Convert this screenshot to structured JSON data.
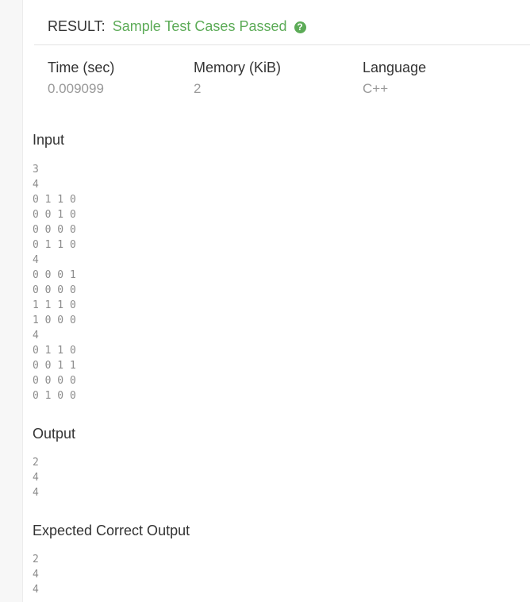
{
  "result": {
    "label": "RESULT:",
    "status": "Sample Test Cases Passed",
    "help_glyph": "?",
    "status_color": "#5cab57"
  },
  "stats": {
    "time_label": "Time (sec)",
    "time_value": "0.009099",
    "memory_label": "Memory (KiB)",
    "memory_value": "2",
    "language_label": "Language",
    "language_value": "C++"
  },
  "input": {
    "title": "Input",
    "lines": [
      "3",
      "4",
      "0 1 1 0",
      "0 0 1 0",
      "0 0 0 0",
      "0 1 1 0",
      "4",
      "0 0 0 1",
      "0 0 0 0",
      "1 1 1 0",
      "1 0 0 0",
      "4",
      "0 1 1 0",
      "0 0 1 1",
      "0 0 0 0",
      "0 1 0 0"
    ]
  },
  "output": {
    "title": "Output",
    "lines": [
      "2",
      "4",
      "4"
    ]
  },
  "expected": {
    "title": "Expected Correct Output",
    "lines": [
      "2",
      "4",
      "4"
    ]
  }
}
